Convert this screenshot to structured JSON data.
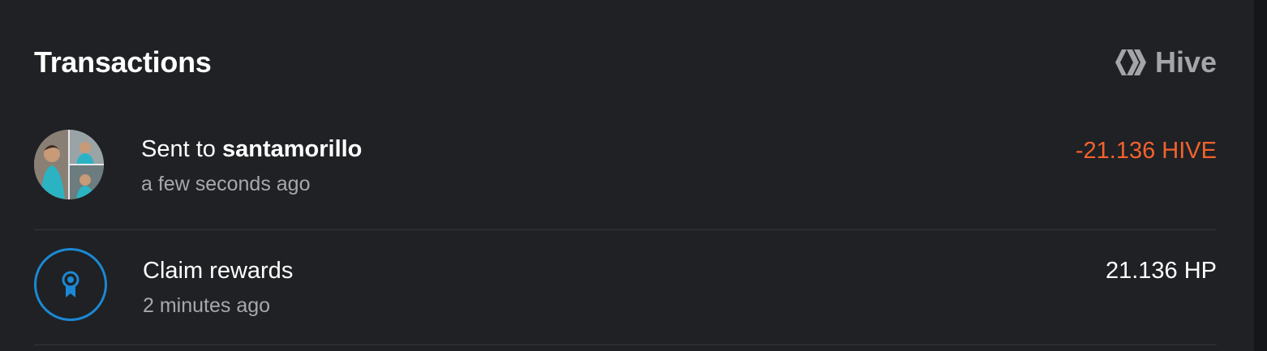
{
  "header": {
    "title": "Transactions",
    "chain_label": "Hive",
    "chain_icon": "hive-logo-icon"
  },
  "transactions": [
    {
      "prefix": "Sent to ",
      "account": "santamorillo",
      "time": "a few seconds ago",
      "amount": "-21.136 HIVE",
      "amount_color": "#f2622d",
      "icon": "user-avatar"
    },
    {
      "prefix": "Claim rewards",
      "account": "",
      "time": "2 minutes ago",
      "amount": "21.136 HP",
      "amount_color": "#ffffff",
      "icon": "award-ribbon-icon"
    }
  ],
  "colors": {
    "background": "#1f2124",
    "accent_blue": "#1b88d4",
    "negative": "#f2622d",
    "muted_text": "#a6a8ab",
    "divider": "#35383c"
  }
}
